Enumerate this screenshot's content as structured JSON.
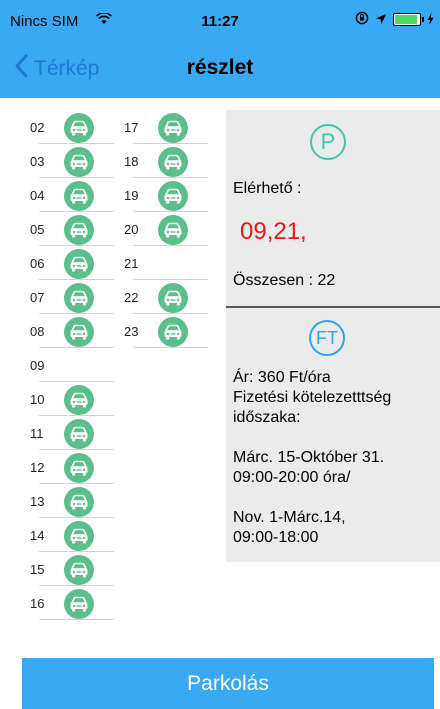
{
  "status_bar": {
    "carrier": "Nincs SIM",
    "time": "11:27",
    "icons": [
      "wifi-icon",
      "rotation-lock-icon",
      "location-arrow-icon",
      "battery-icon",
      "charging-bolt-icon"
    ]
  },
  "navbar": {
    "back_label": "Térkép",
    "title": "részlet"
  },
  "spots_left": [
    {
      "num": "02",
      "car": true
    },
    {
      "num": "03",
      "car": true
    },
    {
      "num": "04",
      "car": true
    },
    {
      "num": "05",
      "car": true
    },
    {
      "num": "06",
      "car": true
    },
    {
      "num": "07",
      "car": true
    },
    {
      "num": "08",
      "car": true
    },
    {
      "num": "09",
      "car": false
    },
    {
      "num": "10",
      "car": true
    },
    {
      "num": "11",
      "car": true
    },
    {
      "num": "12",
      "car": true
    },
    {
      "num": "13",
      "car": true
    },
    {
      "num": "14",
      "car": true
    },
    {
      "num": "15",
      "car": true
    },
    {
      "num": "16",
      "car": true
    }
  ],
  "spots_right": [
    {
      "num": "17",
      "car": true
    },
    {
      "num": "18",
      "car": true
    },
    {
      "num": "19",
      "car": true
    },
    {
      "num": "20",
      "car": true
    },
    {
      "num": "21",
      "car": false
    },
    {
      "num": "22",
      "car": true
    },
    {
      "num": "23",
      "car": true
    }
  ],
  "info": {
    "parking_icon": "P",
    "available_label": "Elérhető :",
    "available_value": "09,21,",
    "total": "Összesen : 22",
    "price_icon": "FT",
    "price_lines": [
      "Ár: 360 Ft/óra",
      "Fizetési kötelezetttség",
      "időszaka:",
      "",
      "Márc. 15-Október 31.",
      "09:00-20:00 óra/",
      "",
      "Nov. 1-Márc.14,",
      "09:00-18:00"
    ]
  },
  "action": {
    "label": "Parkolás"
  },
  "colors": {
    "header": "#3aa9f4",
    "car_badge": "#5bbf8c",
    "available": "#e81818",
    "panel_bg": "#ebebeb"
  }
}
